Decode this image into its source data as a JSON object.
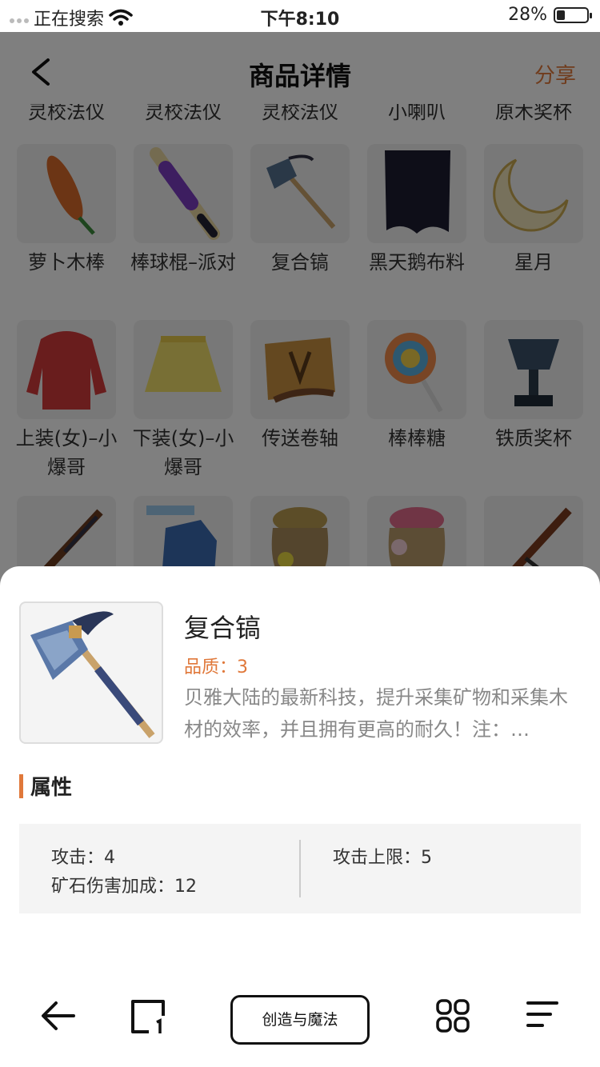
{
  "status_bar": {
    "carrier": "正在搜索",
    "time": "下午8:10",
    "battery": "28%",
    "battery_level": 0.28
  },
  "nav": {
    "title": "商品详情",
    "share": "分享"
  },
  "cut_row": [
    "灵校法仪",
    "灵校法仪",
    "灵校法仪",
    "小喇叭",
    "原木奖杯"
  ],
  "grid": {
    "row1": [
      "萝卜木棒",
      "棒球棍–派对",
      "复合镐",
      "黑天鹅布料",
      "星月"
    ],
    "row2": [
      "上装(女)–小爆哥",
      "下装(女)–小爆哥",
      "传送卷轴",
      "棒棒糖",
      "铁质奖杯"
    ]
  },
  "item": {
    "name": "复合镐",
    "quality": "品质：3",
    "description": "贝雅大陆的最新科技，提升采集矿物和采集木材的效率，并且拥有更高的耐久！注：…"
  },
  "attributes": {
    "title": "属性",
    "attack": "攻击：4",
    "attack_max": "攻击上限：5",
    "ore_bonus": "矿石伤害加成：12"
  },
  "toolbar": {
    "center_label": "创造与魔法"
  },
  "colors": {
    "accent": "#e0783a",
    "dim_overlay": "rgba(0,0,0,0.5)"
  }
}
